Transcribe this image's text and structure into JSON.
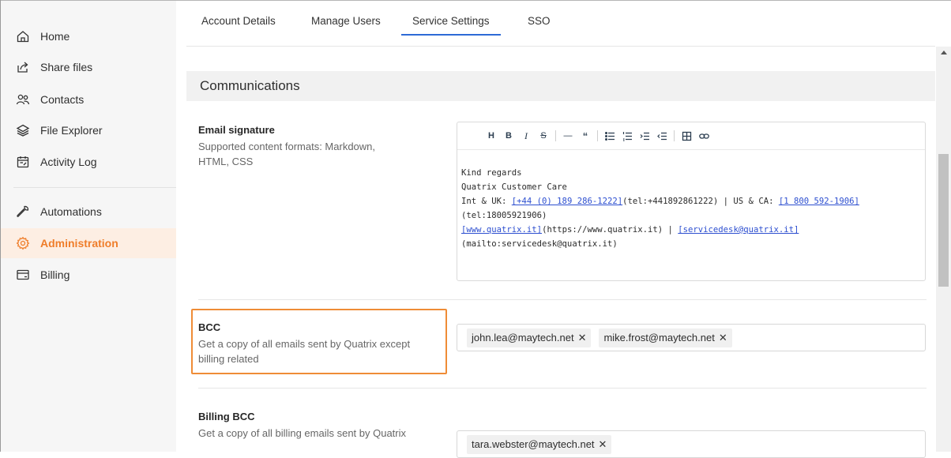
{
  "sidebar": {
    "items": [
      {
        "label": "Home",
        "icon": "home-icon"
      },
      {
        "label": "Share files",
        "icon": "share-icon"
      },
      {
        "label": "Contacts",
        "icon": "contacts-icon"
      },
      {
        "label": "File Explorer",
        "icon": "layers-icon"
      },
      {
        "label": "Activity Log",
        "icon": "activity-log-icon"
      },
      {
        "label": "Automations",
        "icon": "wrench-icon"
      },
      {
        "label": "Administration",
        "icon": "gear-icon",
        "active": true
      },
      {
        "label": "Billing",
        "icon": "card-icon"
      }
    ]
  },
  "tabs": [
    {
      "label": "Account Details"
    },
    {
      "label": "Manage Users"
    },
    {
      "label": "Service Settings",
      "active": true
    },
    {
      "label": "SSO"
    }
  ],
  "section": {
    "title": "Communications"
  },
  "email_signature": {
    "title": "Email signature",
    "desc_line1": "Supported content formats: Markdown,",
    "desc_line2": "HTML, CSS",
    "toolbar": [
      "H",
      "B",
      "I",
      "S",
      "—",
      "“",
      "ul",
      "ol",
      "indent",
      "outdent",
      "table",
      "link"
    ],
    "body": {
      "line1": "Kind regards",
      "line2": "Quatrix Customer Care",
      "line3_a": "Int & UK: ",
      "line3_link1": "[+44 (0) 189 286-1222]",
      "line3_b": "(tel:+441892861222) | US & CA: ",
      "line3_link2": "[1 800 592-1906]",
      "line4": "(tel:18005921906)",
      "line5_link1": "[www.quatrix.it]",
      "line5_b": "(https://www.quatrix.it) | ",
      "line5_link2": "[servicedesk@quatrix.it]",
      "line6": "(mailto:servicedesk@quatrix.it)"
    }
  },
  "bcc": {
    "title": "BCC",
    "desc_line1": "Get a copy of all emails sent by Quatrix except",
    "desc_line2": "billing related",
    "tags": [
      "john.lea@maytech.net",
      "mike.frost@maytech.net"
    ],
    "highlight_color": "#ef8c36"
  },
  "billing_bcc": {
    "title": "Billing BCC",
    "desc_line1": "Get a copy of all billing emails sent by Quatrix",
    "tags": [
      "tara.webster@maytech.net"
    ]
  },
  "colors": {
    "accent": "#ef7d2a",
    "tab_active": "#2d6ad6",
    "link": "#2d4fd0"
  }
}
